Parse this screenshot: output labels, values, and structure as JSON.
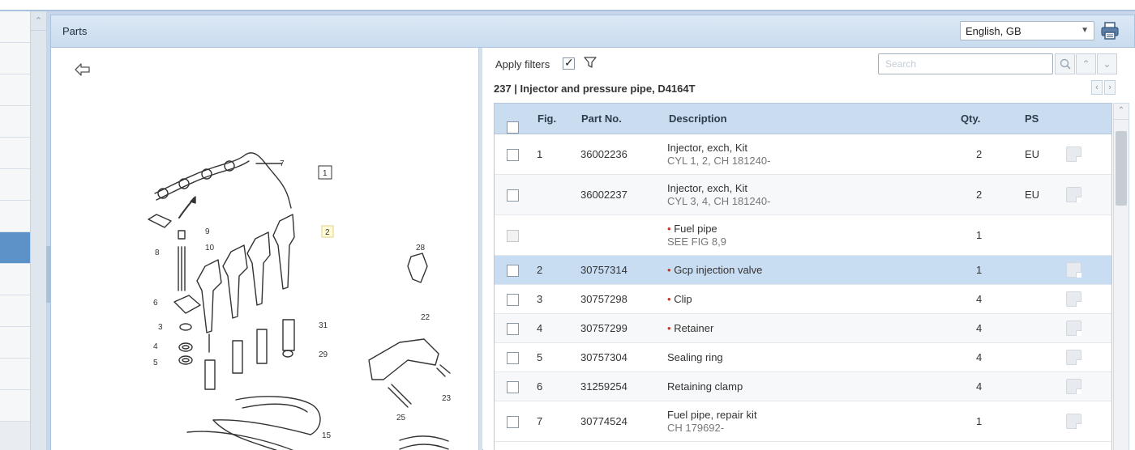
{
  "panel": {
    "title": "Parts"
  },
  "language": {
    "selected": "English, GB"
  },
  "filters": {
    "label": "Apply filters",
    "checked": true
  },
  "search": {
    "placeholder": "Search"
  },
  "section": {
    "title": "237  |  Injector and pressure pipe, D4164T"
  },
  "diagram": {
    "callouts": [
      "1",
      "2",
      "3",
      "4",
      "5",
      "6",
      "7",
      "8",
      "9",
      "10",
      "15",
      "22",
      "23",
      "25",
      "28",
      "29",
      "31"
    ]
  },
  "table": {
    "headers": {
      "fig": "Fig.",
      "part_no": "Part No.",
      "description": "Description",
      "qty": "Qty.",
      "ps": "PS"
    },
    "rows": [
      {
        "fig": "1",
        "part_no": "36002236",
        "description": "Injector, exch, Kit",
        "sub": "CYL 1, 2, CH 181240-",
        "qty": "2",
        "ps": "EU",
        "bullet": false,
        "note": true
      },
      {
        "fig": "",
        "part_no": "36002237",
        "description": "Injector, exch, Kit",
        "sub": "CYL 3, 4, CH 181240-",
        "qty": "2",
        "ps": "EU",
        "bullet": false,
        "note": true
      },
      {
        "fig": "",
        "part_no": "",
        "description": "Fuel pipe",
        "sub": "SEE FIG  8,9",
        "qty": "1",
        "ps": "",
        "bullet": true,
        "note": false,
        "disabled": true
      },
      {
        "fig": "2",
        "part_no": "30757314",
        "description": "Gcp injection valve",
        "sub": "",
        "qty": "1",
        "ps": "",
        "bullet": true,
        "note": true,
        "selected": true
      },
      {
        "fig": "3",
        "part_no": "30757298",
        "description": "Clip",
        "sub": "",
        "qty": "4",
        "ps": "",
        "bullet": true,
        "note": true
      },
      {
        "fig": "4",
        "part_no": "30757299",
        "description": "Retainer",
        "sub": "",
        "qty": "4",
        "ps": "",
        "bullet": true,
        "note": true
      },
      {
        "fig": "5",
        "part_no": "30757304",
        "description": "Sealing ring",
        "sub": "",
        "qty": "4",
        "ps": "",
        "bullet": false,
        "note": true
      },
      {
        "fig": "6",
        "part_no": "31259254",
        "description": "Retaining clamp",
        "sub": "",
        "qty": "4",
        "ps": "",
        "bullet": false,
        "note": true
      },
      {
        "fig": "7",
        "part_no": "30774524",
        "description": "Fuel pipe, repair kit",
        "sub": "CH 179692-",
        "qty": "1",
        "ps": "",
        "bullet": false,
        "note": true
      }
    ]
  },
  "colors": {
    "header_blue": "#c9dcf0",
    "selected_row": "#c8dcf2",
    "accent": "#5b93c9",
    "bullet_red": "#c0392b"
  }
}
